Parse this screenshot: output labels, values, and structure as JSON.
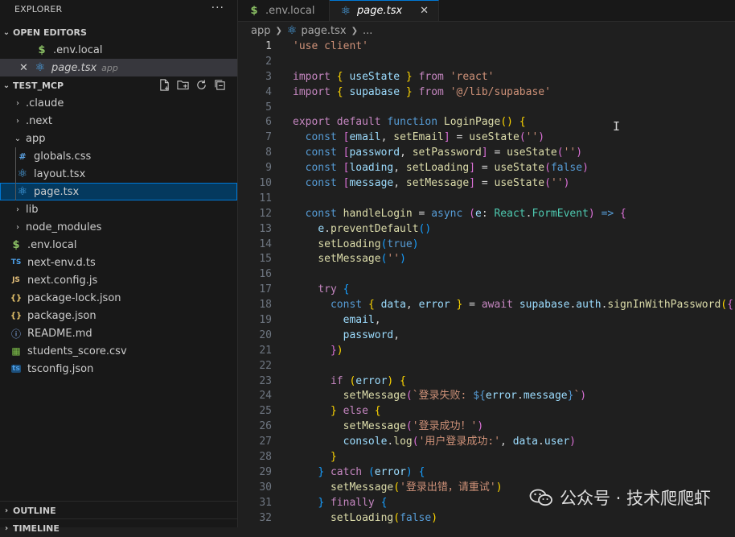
{
  "sidebar": {
    "title": "EXPLORER",
    "more": "···",
    "open_editors_label": "OPEN EDITORS",
    "open_editors": [
      {
        "name": ".env.local",
        "desc": ""
      },
      {
        "name": "page.tsx",
        "desc": "app"
      }
    ],
    "folder_label": "TEST_MCP",
    "tree": [
      {
        "name": ".claude"
      },
      {
        "name": ".next"
      },
      {
        "name": "app"
      },
      {
        "name": "globals.css"
      },
      {
        "name": "layout.tsx"
      },
      {
        "name": "page.tsx"
      },
      {
        "name": "lib"
      },
      {
        "name": "node_modules"
      },
      {
        "name": ".env.local"
      },
      {
        "name": "next-env.d.ts"
      },
      {
        "name": "next.config.js"
      },
      {
        "name": "package-lock.json"
      },
      {
        "name": "package.json"
      },
      {
        "name": "README.md"
      },
      {
        "name": "students_score.csv"
      },
      {
        "name": "tsconfig.json"
      }
    ],
    "outline_label": "OUTLINE",
    "timeline_label": "TIMELINE"
  },
  "tabs": [
    {
      "label": ".env.local"
    },
    {
      "label": "page.tsx"
    }
  ],
  "breadcrumb": {
    "folder": "app",
    "file": "page.tsx",
    "more": "..."
  },
  "line_numbers": [
    "1",
    "2",
    "3",
    "4",
    "5",
    "6",
    "7",
    "8",
    "9",
    "10",
    "11",
    "12",
    "13",
    "14",
    "15",
    "16",
    "17",
    "18",
    "19",
    "20",
    "21",
    "22",
    "23",
    "24",
    "25",
    "26",
    "27",
    "28",
    "29",
    "30",
    "31",
    "32"
  ],
  "code_lines": [
    [
      [
        "str",
        "'use client'"
      ]
    ],
    [],
    [
      [
        "ctl",
        "import"
      ],
      [
        "pun",
        " "
      ],
      [
        "b1",
        "{"
      ],
      [
        "pun",
        " "
      ],
      [
        "var",
        "useState"
      ],
      [
        "pun",
        " "
      ],
      [
        "b1",
        "}"
      ],
      [
        "pun",
        " "
      ],
      [
        "ctl",
        "from"
      ],
      [
        "pun",
        " "
      ],
      [
        "str",
        "'react'"
      ]
    ],
    [
      [
        "ctl",
        "import"
      ],
      [
        "pun",
        " "
      ],
      [
        "b1",
        "{"
      ],
      [
        "pun",
        " "
      ],
      [
        "var",
        "supabase"
      ],
      [
        "pun",
        " "
      ],
      [
        "b1",
        "}"
      ],
      [
        "pun",
        " "
      ],
      [
        "ctl",
        "from"
      ],
      [
        "pun",
        " "
      ],
      [
        "str",
        "'@/lib/supabase'"
      ]
    ],
    [],
    [
      [
        "ctl",
        "export"
      ],
      [
        "pun",
        " "
      ],
      [
        "ctl",
        "default"
      ],
      [
        "pun",
        " "
      ],
      [
        "kw",
        "function"
      ],
      [
        "pun",
        " "
      ],
      [
        "fn",
        "LoginPage"
      ],
      [
        "b1",
        "()"
      ],
      [
        "pun",
        " "
      ],
      [
        "b1",
        "{"
      ]
    ],
    [
      [
        "pun",
        "  "
      ],
      [
        "kw",
        "const"
      ],
      [
        "pun",
        " "
      ],
      [
        "b2",
        "["
      ],
      [
        "var",
        "email"
      ],
      [
        "pun",
        ", "
      ],
      [
        "fn",
        "setEmail"
      ],
      [
        "b2",
        "]"
      ],
      [
        "pun",
        " = "
      ],
      [
        "fn",
        "useState"
      ],
      [
        "b2",
        "("
      ],
      [
        "str",
        "''"
      ],
      [
        "b2",
        ")"
      ]
    ],
    [
      [
        "pun",
        "  "
      ],
      [
        "kw",
        "const"
      ],
      [
        "pun",
        " "
      ],
      [
        "b2",
        "["
      ],
      [
        "var",
        "password"
      ],
      [
        "pun",
        ", "
      ],
      [
        "fn",
        "setPassword"
      ],
      [
        "b2",
        "]"
      ],
      [
        "pun",
        " = "
      ],
      [
        "fn",
        "useState"
      ],
      [
        "b2",
        "("
      ],
      [
        "str",
        "''"
      ],
      [
        "b2",
        ")"
      ]
    ],
    [
      [
        "pun",
        "  "
      ],
      [
        "kw",
        "const"
      ],
      [
        "pun",
        " "
      ],
      [
        "b2",
        "["
      ],
      [
        "var",
        "loading"
      ],
      [
        "pun",
        ", "
      ],
      [
        "fn",
        "setLoading"
      ],
      [
        "b2",
        "]"
      ],
      [
        "pun",
        " = "
      ],
      [
        "fn",
        "useState"
      ],
      [
        "b2",
        "("
      ],
      [
        "kw",
        "false"
      ],
      [
        "b2",
        ")"
      ]
    ],
    [
      [
        "pun",
        "  "
      ],
      [
        "kw",
        "const"
      ],
      [
        "pun",
        " "
      ],
      [
        "b2",
        "["
      ],
      [
        "var",
        "message"
      ],
      [
        "pun",
        ", "
      ],
      [
        "fn",
        "setMessage"
      ],
      [
        "b2",
        "]"
      ],
      [
        "pun",
        " = "
      ],
      [
        "fn",
        "useState"
      ],
      [
        "b2",
        "("
      ],
      [
        "str",
        "''"
      ],
      [
        "b2",
        ")"
      ]
    ],
    [],
    [
      [
        "pun",
        "  "
      ],
      [
        "kw",
        "const"
      ],
      [
        "pun",
        " "
      ],
      [
        "fn",
        "handleLogin"
      ],
      [
        "pun",
        " = "
      ],
      [
        "kw",
        "async"
      ],
      [
        "pun",
        " "
      ],
      [
        "b2",
        "("
      ],
      [
        "var",
        "e"
      ],
      [
        "pun",
        ": "
      ],
      [
        "typ",
        "React"
      ],
      [
        "pun",
        "."
      ],
      [
        "typ",
        "FormEvent"
      ],
      [
        "b2",
        ")"
      ],
      [
        "pun",
        " "
      ],
      [
        "kw",
        "=>"
      ],
      [
        "pun",
        " "
      ],
      [
        "b2",
        "{"
      ]
    ],
    [
      [
        "pun",
        "    "
      ],
      [
        "var",
        "e"
      ],
      [
        "pun",
        "."
      ],
      [
        "fn",
        "preventDefault"
      ],
      [
        "b3",
        "()"
      ]
    ],
    [
      [
        "pun",
        "    "
      ],
      [
        "fn",
        "setLoading"
      ],
      [
        "b3",
        "("
      ],
      [
        "kw",
        "true"
      ],
      [
        "b3",
        ")"
      ]
    ],
    [
      [
        "pun",
        "    "
      ],
      [
        "fn",
        "setMessage"
      ],
      [
        "b3",
        "("
      ],
      [
        "str",
        "''"
      ],
      [
        "b3",
        ")"
      ]
    ],
    [],
    [
      [
        "pun",
        "    "
      ],
      [
        "ctl",
        "try"
      ],
      [
        "pun",
        " "
      ],
      [
        "b3",
        "{"
      ]
    ],
    [
      [
        "pun",
        "      "
      ],
      [
        "kw",
        "const"
      ],
      [
        "pun",
        " "
      ],
      [
        "b1",
        "{"
      ],
      [
        "pun",
        " "
      ],
      [
        "var",
        "data"
      ],
      [
        "pun",
        ", "
      ],
      [
        "var",
        "error"
      ],
      [
        "pun",
        " "
      ],
      [
        "b1",
        "}"
      ],
      [
        "pun",
        " = "
      ],
      [
        "ctl",
        "await"
      ],
      [
        "pun",
        " "
      ],
      [
        "var",
        "supabase"
      ],
      [
        "pun",
        "."
      ],
      [
        "var",
        "auth"
      ],
      [
        "pun",
        "."
      ],
      [
        "fn",
        "signInWithPassword"
      ],
      [
        "b1",
        "("
      ],
      [
        "b2",
        "{"
      ]
    ],
    [
      [
        "pun",
        "        "
      ],
      [
        "var",
        "email"
      ],
      [
        "pun",
        ","
      ]
    ],
    [
      [
        "pun",
        "        "
      ],
      [
        "var",
        "password"
      ],
      [
        "pun",
        ","
      ]
    ],
    [
      [
        "pun",
        "      "
      ],
      [
        "b2",
        "}"
      ],
      [
        "b1",
        ")"
      ]
    ],
    [],
    [
      [
        "pun",
        "      "
      ],
      [
        "ctl",
        "if"
      ],
      [
        "pun",
        " "
      ],
      [
        "b1",
        "("
      ],
      [
        "var",
        "error"
      ],
      [
        "b1",
        ")"
      ],
      [
        "pun",
        " "
      ],
      [
        "b1",
        "{"
      ]
    ],
    [
      [
        "pun",
        "        "
      ],
      [
        "fn",
        "setMessage"
      ],
      [
        "b2",
        "("
      ],
      [
        "str",
        "`登录失败: "
      ],
      [
        "kw",
        "${"
      ],
      [
        "var",
        "error"
      ],
      [
        "pun",
        "."
      ],
      [
        "var",
        "message"
      ],
      [
        "kw",
        "}"
      ],
      [
        "str",
        "`"
      ],
      [
        "b2",
        ")"
      ]
    ],
    [
      [
        "pun",
        "      "
      ],
      [
        "b1",
        "}"
      ],
      [
        "pun",
        " "
      ],
      [
        "ctl",
        "else"
      ],
      [
        "pun",
        " "
      ],
      [
        "b1",
        "{"
      ]
    ],
    [
      [
        "pun",
        "        "
      ],
      [
        "fn",
        "setMessage"
      ],
      [
        "b2",
        "("
      ],
      [
        "str",
        "'登录成功！'"
      ],
      [
        "b2",
        ")"
      ]
    ],
    [
      [
        "pun",
        "        "
      ],
      [
        "var",
        "console"
      ],
      [
        "pun",
        "."
      ],
      [
        "fn",
        "log"
      ],
      [
        "b2",
        "("
      ],
      [
        "str",
        "'用户登录成功:'"
      ],
      [
        "pun",
        ", "
      ],
      [
        "var",
        "data"
      ],
      [
        "pun",
        "."
      ],
      [
        "var",
        "user"
      ],
      [
        "b2",
        ")"
      ]
    ],
    [
      [
        "pun",
        "      "
      ],
      [
        "b1",
        "}"
      ]
    ],
    [
      [
        "pun",
        "    "
      ],
      [
        "b3",
        "}"
      ],
      [
        "pun",
        " "
      ],
      [
        "ctl",
        "catch"
      ],
      [
        "pun",
        " "
      ],
      [
        "b3",
        "("
      ],
      [
        "var",
        "error"
      ],
      [
        "b3",
        ")"
      ],
      [
        "pun",
        " "
      ],
      [
        "b3",
        "{"
      ]
    ],
    [
      [
        "pun",
        "      "
      ],
      [
        "fn",
        "setMessage"
      ],
      [
        "b1",
        "("
      ],
      [
        "str",
        "'登录出错，请重试'"
      ],
      [
        "b1",
        ")"
      ]
    ],
    [
      [
        "pun",
        "    "
      ],
      [
        "b3",
        "}"
      ],
      [
        "pun",
        " "
      ],
      [
        "ctl",
        "finally"
      ],
      [
        "pun",
        " "
      ],
      [
        "b3",
        "{"
      ]
    ],
    [
      [
        "pun",
        "      "
      ],
      [
        "fn",
        "setLoading"
      ],
      [
        "b1",
        "("
      ],
      [
        "kw",
        "false"
      ],
      [
        "b1",
        ")"
      ]
    ]
  ],
  "watermark": {
    "text": "公众号 · 技术爬爬虾"
  },
  "colors": {
    "accent": "#0078d4",
    "selection": "#04395e"
  }
}
